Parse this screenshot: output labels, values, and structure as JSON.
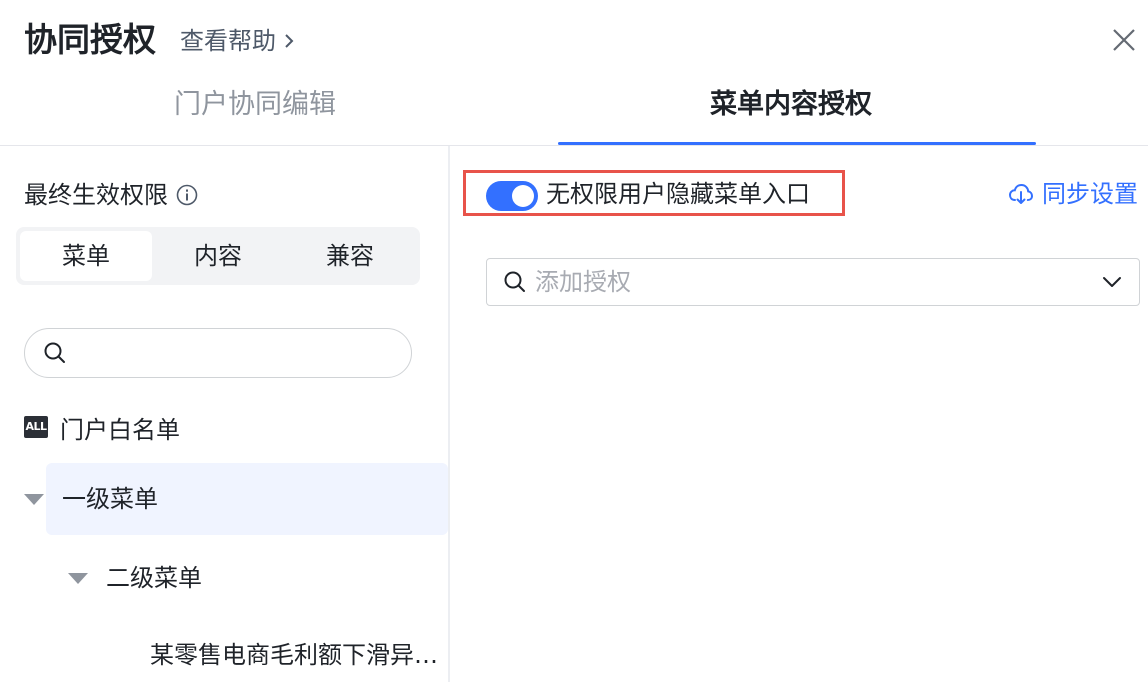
{
  "header": {
    "title": "协同授权",
    "help_label": "查看帮助"
  },
  "tabs": [
    {
      "label": "门户协同编辑",
      "active": false
    },
    {
      "label": "菜单内容授权",
      "active": true
    }
  ],
  "left_panel": {
    "permission_title": "最终生效权限",
    "segments": [
      {
        "label": "菜单",
        "active": true
      },
      {
        "label": "内容",
        "active": false
      },
      {
        "label": "兼容",
        "active": false
      }
    ],
    "search": {
      "placeholder": "",
      "value": ""
    },
    "tree": {
      "all_badge": "ALL",
      "root_label": "门户白名单",
      "level1_label": "一级菜单",
      "level2_label": "二级菜单",
      "level3_label": "某零售电商毛利额下滑异常分析"
    }
  },
  "right_panel": {
    "toggle": {
      "label": "无权限用户隐藏菜单入口",
      "on": true
    },
    "sync_label": "同步设置",
    "add_auth": {
      "placeholder": "添加授权"
    }
  },
  "colors": {
    "accent": "#3370ff",
    "highlight_border": "#e8534a",
    "selected_row_bg": "#f0f4ff"
  },
  "icons": [
    "chevron-right-icon",
    "close-icon",
    "info-icon",
    "search-icon",
    "all-icon",
    "caret-down-icon",
    "cloud-download-icon",
    "chevron-down-icon"
  ]
}
